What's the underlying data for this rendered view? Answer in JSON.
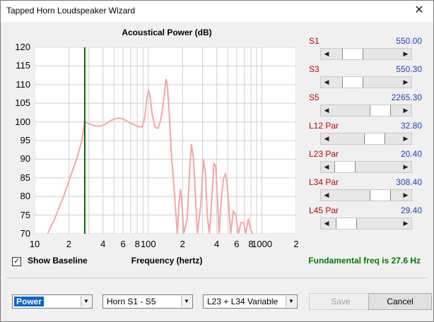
{
  "window": {
    "title": "Tapped Horn Loudspeaker Wizard"
  },
  "chart_data": {
    "type": "line",
    "title": "Acoustical Power (dB)",
    "xlabel": "Frequency (hertz)",
    "ylabel": "",
    "x_scale": "log",
    "xlim": [
      10,
      2000
    ],
    "ylim": [
      70,
      120
    ],
    "y_ticks": [
      "120",
      "115",
      "110",
      "105",
      "100",
      "95",
      "90",
      "85",
      "80",
      "75",
      "70"
    ],
    "x_ticks": [
      "10",
      "2",
      "4",
      "6",
      "8",
      "100",
      "2",
      "4",
      "6",
      "8",
      "1000",
      "2"
    ],
    "marker_frequency": 27.6,
    "series": [
      {
        "values": [
          [
            13,
            70
          ],
          [
            15,
            74
          ],
          [
            18,
            80
          ],
          [
            21,
            86
          ],
          [
            24,
            91
          ],
          [
            26,
            95
          ],
          [
            27.6,
            100
          ],
          [
            30,
            99.5
          ],
          [
            33,
            99
          ],
          [
            37,
            98.8
          ],
          [
            41,
            99.2
          ],
          [
            46,
            100.2
          ],
          [
            50,
            100.8
          ],
          [
            55,
            101
          ],
          [
            60,
            100.8
          ],
          [
            65,
            100.2
          ],
          [
            72,
            99.5
          ],
          [
            80,
            98.8
          ],
          [
            88,
            98.6
          ],
          [
            93,
            101
          ],
          [
            97,
            106
          ],
          [
            100,
            108.5
          ],
          [
            103,
            107.5
          ],
          [
            108,
            102
          ],
          [
            115,
            98.5
          ],
          [
            122,
            98.3
          ],
          [
            130,
            101
          ],
          [
            138,
            107
          ],
          [
            143,
            111.5
          ],
          [
            147,
            110
          ],
          [
            153,
            102
          ],
          [
            160,
            91
          ],
          [
            168,
            83
          ],
          [
            175,
            75
          ],
          [
            180,
            70
          ],
          [
            186,
            78
          ],
          [
            192,
            82
          ],
          [
            198,
            78
          ],
          [
            205,
            70
          ],
          [
            220,
            74
          ],
          [
            232,
            88
          ],
          [
            240,
            94
          ],
          [
            250,
            90
          ],
          [
            260,
            80
          ],
          [
            270,
            70
          ],
          [
            290,
            78
          ],
          [
            305,
            90
          ],
          [
            318,
            86
          ],
          [
            330,
            75
          ],
          [
            345,
            70
          ],
          [
            360,
            78
          ],
          [
            378,
            89
          ],
          [
            392,
            88
          ],
          [
            405,
            80
          ],
          [
            420,
            70
          ],
          [
            440,
            80
          ],
          [
            460,
            85
          ],
          [
            478,
            86
          ],
          [
            495,
            83
          ],
          [
            512,
            77
          ],
          [
            530,
            70
          ],
          [
            560,
            76
          ],
          [
            590,
            75
          ],
          [
            620,
            70
          ],
          [
            655,
            73
          ],
          [
            690,
            73
          ],
          [
            720,
            70
          ],
          [
            760,
            74
          ],
          [
            800,
            71
          ],
          [
            830,
            70
          ]
        ]
      }
    ]
  },
  "sliders": [
    {
      "label": "S1",
      "value": "550.00",
      "level": 0.2
    },
    {
      "label": "S3",
      "value": "550.30",
      "level": 0.2
    },
    {
      "label": "S5",
      "value": "2265.30",
      "level": 0.78
    },
    {
      "label": "L12  Par",
      "value": "32.80",
      "level": 0.66
    },
    {
      "label": "L23  Par",
      "value": "20.40",
      "level": 0.04
    },
    {
      "label": "L34  Par",
      "value": "308.40",
      "level": 0.78
    },
    {
      "label": "L45  Par",
      "value": "29.40",
      "level": 0.07
    }
  ],
  "controls": {
    "show_baseline": "Show Baseline",
    "show_baseline_checked": "✓",
    "frequency_label": "Frequency (hertz)",
    "fundamental": "Fundamental freq is 27.6 Hz",
    "combo1": "Power",
    "combo2": "Horn S1 - S5",
    "combo3": "L23 + L34 Variable",
    "save": "Save",
    "cancel": "Cancel"
  },
  "colors": {
    "curve": "#f4a6a6",
    "marker": "#006400",
    "grid": "#d0d0d0",
    "fundamental": "#007a00"
  }
}
